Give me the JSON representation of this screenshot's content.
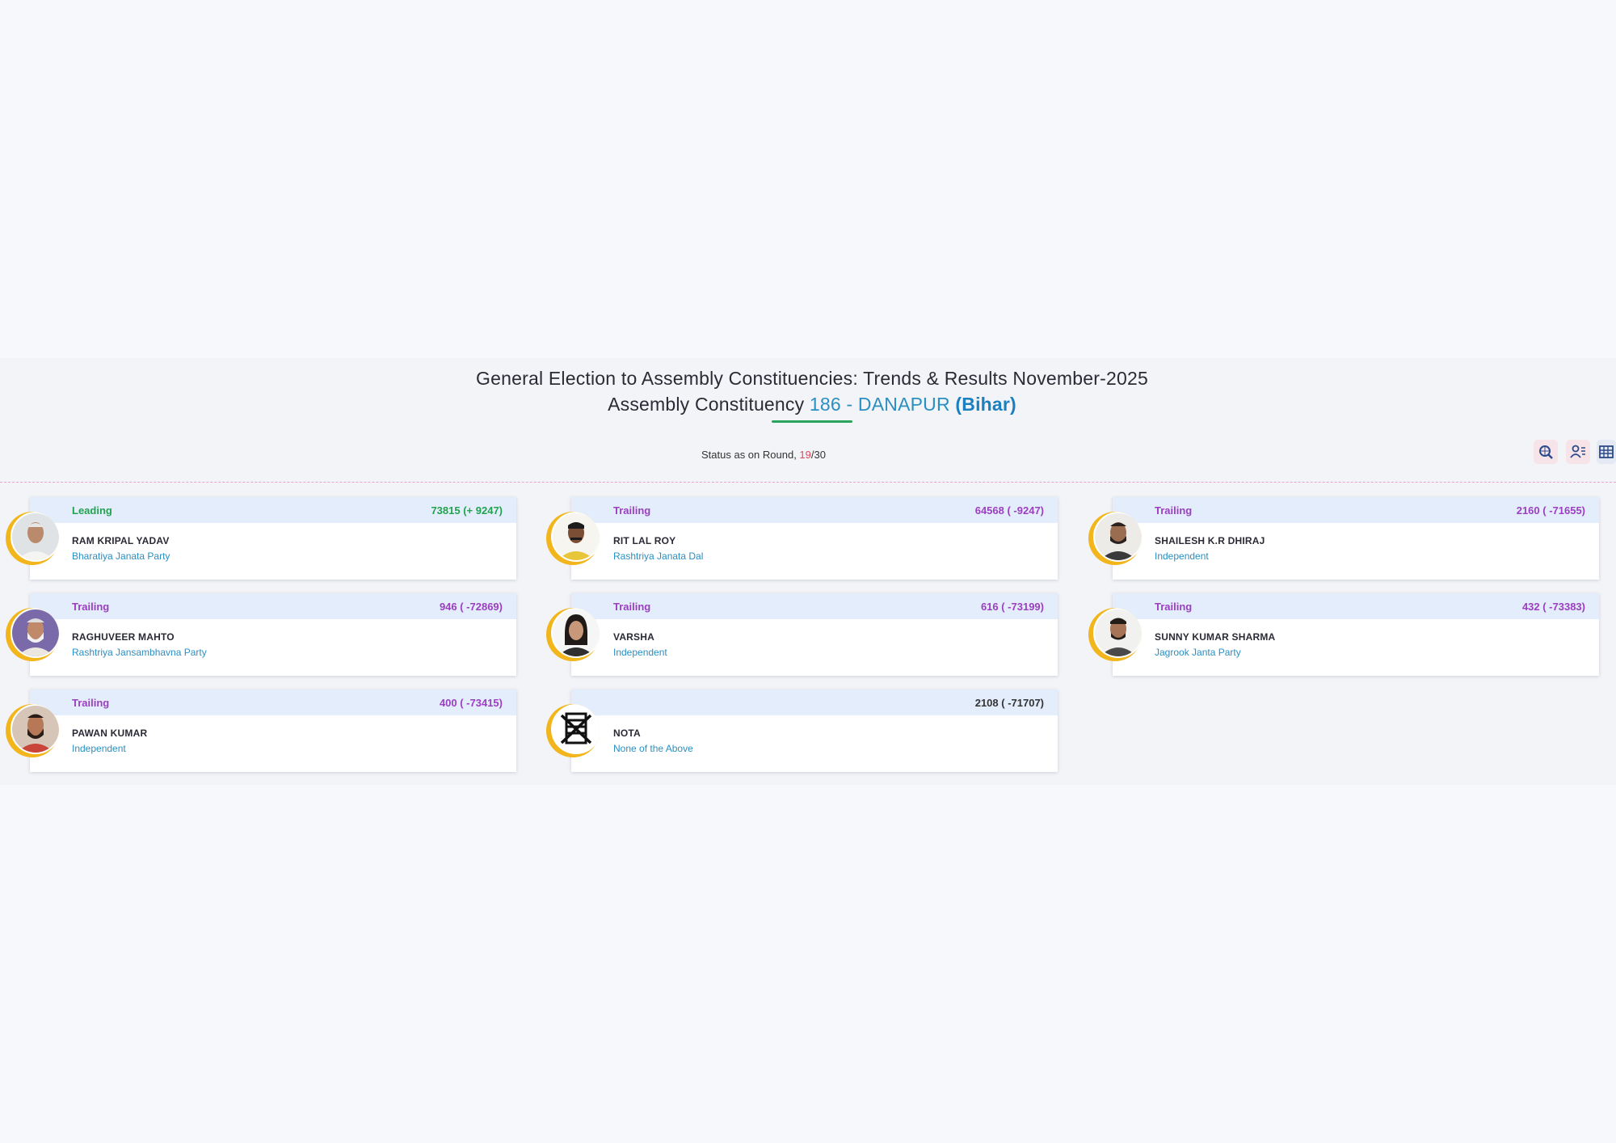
{
  "header": {
    "title_line1": "General Election to Assembly Constituencies: Trends & Results November-2025",
    "title_line2_prefix": "Assembly Constituency ",
    "ac_number_name": "186 - DANAPUR",
    "ac_state": "(Bihar)"
  },
  "status": {
    "label": "Status as on Round, ",
    "current_round": "19",
    "total_rounds": "/30"
  },
  "toolbar": {
    "icons": [
      "globe-search-icon",
      "user-list-icon",
      "table-grid-icon"
    ]
  },
  "colors": {
    "leading": "#23a24f",
    "trailing": "#9b3fc1",
    "accent_blue": "#2a8fc2",
    "avatar_ring": "#f2b51c",
    "card_header": "#e3edfb"
  },
  "candidates": [
    {
      "status": "Leading",
      "votes": "73815 (+ 9247)",
      "name": "RAM KRIPAL YADAV",
      "party": "Bharatiya Janata Party"
    },
    {
      "status": "Trailing",
      "votes": "64568 ( -9247)",
      "name": "RIT LAL ROY",
      "party": "Rashtriya Janata Dal"
    },
    {
      "status": "Trailing",
      "votes": "2160 ( -71655)",
      "name": "SHAILESH K.R DHIRAJ",
      "party": "Independent"
    },
    {
      "status": "Trailing",
      "votes": "946 ( -72869)",
      "name": "RAGHUVEER MAHTO",
      "party": "Rashtriya Jansambhavna Party"
    },
    {
      "status": "Trailing",
      "votes": "616 ( -73199)",
      "name": "VARSHA",
      "party": "Independent"
    },
    {
      "status": "Trailing",
      "votes": "432 ( -73383)",
      "name": "SUNNY KUMAR SHARMA",
      "party": "Jagrook Janta Party"
    },
    {
      "status": "Trailing",
      "votes": "400 ( -73415)",
      "name": "PAWAN KUMAR",
      "party": "Independent"
    },
    {
      "status": "",
      "votes": "2108 ( -71707)",
      "name": "NOTA",
      "party": "None of the Above"
    }
  ]
}
